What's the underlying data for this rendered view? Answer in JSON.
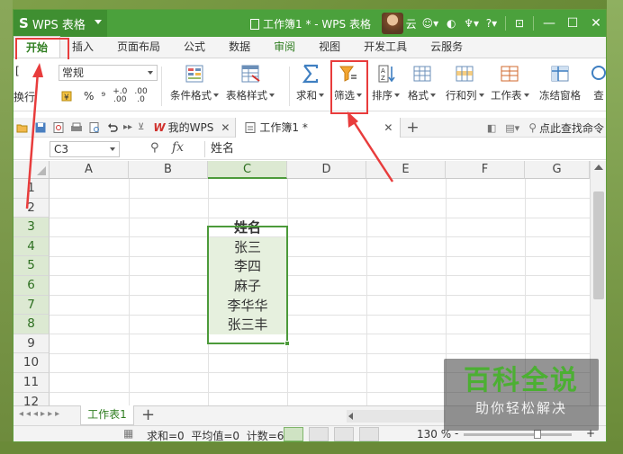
{
  "titlebar": {
    "app_logo": "S",
    "app_name": "WPS 表格",
    "doc_title": "工作簿1 * - WPS 表格",
    "user_label": "云",
    "help_label": "?"
  },
  "ribbon_tabs": [
    "开始",
    "插入",
    "页面布局",
    "公式",
    "数据",
    "审阅",
    "视图",
    "开发工具",
    "云服务"
  ],
  "ribbon": {
    "left_cut_top": "[",
    "left_cut_bottom": "换行",
    "number_format": "常规",
    "percent": "%",
    "thousands": "⁹",
    "dec_inc": ".00",
    "dec_dec": ".0",
    "cond_format": "条件格式",
    "table_style": "表格样式",
    "sum": "求和",
    "filter": "筛选",
    "sort": "排序",
    "format": "格式",
    "rows_cols": "行和列",
    "worksheet": "工作表",
    "freeze": "冻结窗格",
    "find": "查"
  },
  "doc_tabs": {
    "my_wps": "我的WPS",
    "workbook": "工作簿1 *",
    "add": "+",
    "search_placeholder": "点此查找命令"
  },
  "formula_bar": {
    "cell_ref": "C3",
    "fx": "fx",
    "content": "姓名"
  },
  "grid": {
    "columns": [
      "A",
      "B",
      "C",
      "D",
      "E",
      "F",
      "G"
    ],
    "rows": [
      "1",
      "2",
      "3",
      "4",
      "5",
      "6",
      "7",
      "8",
      "9",
      "10",
      "11",
      "12"
    ],
    "cells_c": [
      "姓名",
      "张三",
      "李四",
      "麻子",
      "李华华",
      "张三丰"
    ]
  },
  "sheets": {
    "active": "工作表1",
    "add": "+"
  },
  "status_bar": {
    "sum": "求和=0",
    "avg": "平均值=0",
    "count": "计数=6",
    "zoom": "130 %",
    "minus": "-",
    "plus": "+"
  },
  "watermark": {
    "title": "百科全说",
    "subtitle": "助你轻松解决"
  },
  "colors": {
    "accent": "#4ba13c",
    "highlight": "#e83c3c",
    "selection": "#4c9a3a"
  }
}
